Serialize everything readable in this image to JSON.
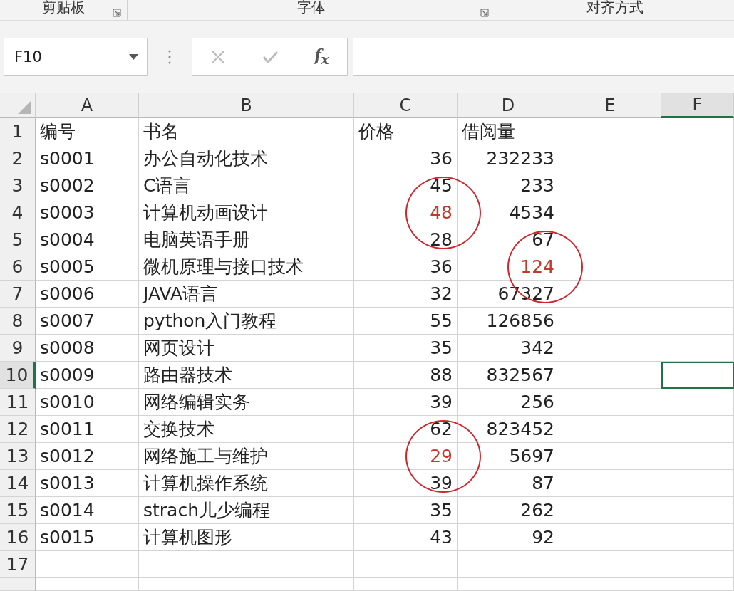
{
  "ribbon_groups": [
    {
      "label": "剪贴板",
      "launcher": true
    },
    {
      "label": "字体",
      "launcher": true
    },
    {
      "label": "对齐方式",
      "launcher": false
    }
  ],
  "formula_bar": {
    "name_box": "F10",
    "insert_function": "f$_{x}$"
  },
  "columns": [
    {
      "label": "A",
      "selected": false
    },
    {
      "label": "B",
      "selected": false
    },
    {
      "label": "C",
      "selected": false
    },
    {
      "label": "D",
      "selected": false
    },
    {
      "label": "E",
      "selected": false
    },
    {
      "label": "F",
      "selected": true
    }
  ],
  "rows": [
    {
      "number": "1",
      "selected": false,
      "kind": "header",
      "cells": [
        {
          "text": "编号",
          "marked": false
        },
        {
          "text": "书名",
          "marked": false
        },
        {
          "text": "价格",
          "marked": false
        },
        {
          "text": "借阅量",
          "marked": false
        }
      ]
    },
    {
      "number": "2",
      "selected": false,
      "cells": [
        {
          "text": "s0001",
          "marked": false
        },
        {
          "text": "办公自动化技术",
          "marked": false
        },
        {
          "text": "36",
          "marked": false
        },
        {
          "text": "232233",
          "marked": false
        }
      ]
    },
    {
      "number": "3",
      "selected": false,
      "cells": [
        {
          "text": "s0002",
          "marked": false
        },
        {
          "text": "C语言",
          "marked": false
        },
        {
          "text": "45",
          "marked": false
        },
        {
          "text": "233",
          "marked": false
        }
      ]
    },
    {
      "number": "4",
      "selected": false,
      "cells": [
        {
          "text": "s0003",
          "marked": false
        },
        {
          "text": "计算机动画设计",
          "marked": false
        },
        {
          "text": "48",
          "marked": true
        },
        {
          "text": "4534",
          "marked": false
        }
      ]
    },
    {
      "number": "5",
      "selected": false,
      "cells": [
        {
          "text": "s0004",
          "marked": false
        },
        {
          "text": "电脑英语手册",
          "marked": false
        },
        {
          "text": "28",
          "marked": false
        },
        {
          "text": "67",
          "marked": false
        }
      ]
    },
    {
      "number": "6",
      "selected": false,
      "cells": [
        {
          "text": "s0005",
          "marked": false
        },
        {
          "text": "微机原理与接口技术",
          "marked": false
        },
        {
          "text": "36",
          "marked": false
        },
        {
          "text": "124",
          "marked": true
        }
      ]
    },
    {
      "number": "7",
      "selected": false,
      "cells": [
        {
          "text": "s0006",
          "marked": false
        },
        {
          "text": "JAVA语言",
          "marked": false
        },
        {
          "text": "32",
          "marked": false
        },
        {
          "text": "67327",
          "marked": false
        }
      ]
    },
    {
      "number": "8",
      "selected": false,
      "cells": [
        {
          "text": "s0007",
          "marked": false
        },
        {
          "text": "python入门教程",
          "marked": false
        },
        {
          "text": "55",
          "marked": false
        },
        {
          "text": "126856",
          "marked": false
        }
      ]
    },
    {
      "number": "9",
      "selected": false,
      "cells": [
        {
          "text": "s0008",
          "marked": false
        },
        {
          "text": "网页设计",
          "marked": false
        },
        {
          "text": "35",
          "marked": false
        },
        {
          "text": "342",
          "marked": false
        }
      ]
    },
    {
      "number": "10",
      "selected": true,
      "cells": [
        {
          "text": "s0009",
          "marked": false
        },
        {
          "text": "路由器技术",
          "marked": false
        },
        {
          "text": "88",
          "marked": false
        },
        {
          "text": "832567",
          "marked": false
        }
      ]
    },
    {
      "number": "11",
      "selected": false,
      "cells": [
        {
          "text": "s0010",
          "marked": false
        },
        {
          "text": "网络编辑实务",
          "marked": false
        },
        {
          "text": "39",
          "marked": false
        },
        {
          "text": "256",
          "marked": false
        }
      ]
    },
    {
      "number": "12",
      "selected": false,
      "cells": [
        {
          "text": "s0011",
          "marked": false
        },
        {
          "text": "交换技术",
          "marked": false
        },
        {
          "text": "62",
          "marked": false
        },
        {
          "text": "823452",
          "marked": false
        }
      ]
    },
    {
      "number": "13",
      "selected": false,
      "cells": [
        {
          "text": "s0012",
          "marked": false
        },
        {
          "text": "网络施工与维护",
          "marked": false
        },
        {
          "text": "29",
          "marked": true
        },
        {
          "text": "5697",
          "marked": false
        }
      ]
    },
    {
      "number": "14",
      "selected": false,
      "cells": [
        {
          "text": "s0013",
          "marked": false
        },
        {
          "text": "计算机操作系统",
          "marked": false
        },
        {
          "text": "39",
          "marked": false
        },
        {
          "text": "87",
          "marked": false
        }
      ]
    },
    {
      "number": "15",
      "selected": false,
      "cells": [
        {
          "text": "s0014",
          "marked": false
        },
        {
          "text": "strach儿少编程",
          "marked": false
        },
        {
          "text": "35",
          "marked": false
        },
        {
          "text": "262",
          "marked": false
        }
      ]
    },
    {
      "number": "16",
      "selected": false,
      "cells": [
        {
          "text": "s0015",
          "marked": false
        },
        {
          "text": "计算机图形",
          "marked": false
        },
        {
          "text": "43",
          "marked": false
        },
        {
          "text": "92",
          "marked": false
        }
      ]
    },
    {
      "number": "17",
      "selected": false,
      "cells": []
    }
  ]
}
